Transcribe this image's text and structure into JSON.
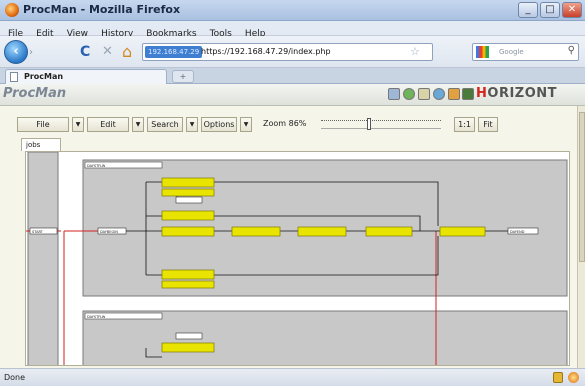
{
  "window": {
    "title": "ProcMan - Mozilla Firefox",
    "minimize": "_",
    "maximize": "□",
    "close": "✕"
  },
  "menu": [
    "File",
    "Edit",
    "View",
    "History",
    "Bookmarks",
    "Tools",
    "Help"
  ],
  "nav": {
    "back": "‹",
    "forward": "›",
    "reload": "C",
    "stop": "✕",
    "home": "⌂",
    "site_badge": "192.168.47.29",
    "url": "https://192.168.47.29/index.php",
    "bookmark_star": "☆",
    "search_placeholder": "Google",
    "search_icon": "search-icon"
  },
  "tabs": {
    "active": "ProcMan",
    "new_tab": "+"
  },
  "app": {
    "name": "ProcMan",
    "brand_prefix": "H",
    "brand_rest": "ORIZONT",
    "toolbar": {
      "file": "File",
      "edit": "Edit",
      "search": "Search",
      "options": "Options",
      "dropdown": "▼",
      "zoom_label": "Zoom 86%",
      "zoom_percent": 86,
      "one_to_one": "1:1",
      "fit": "Fit"
    },
    "tab_jobs": "jobs"
  },
  "diagram": {
    "group1_label": "DAYSTFLW",
    "group2_label": "DAYSTFLW",
    "start_node": "START",
    "entry_node": "DAYBEGIN",
    "end_node": "DAYEND",
    "colors": {
      "job": "#e8e400",
      "job_border": "#7f7a00",
      "flow": "#d21f1f",
      "group_bg": "#c8c8c8"
    }
  },
  "status": {
    "text": "Done"
  }
}
